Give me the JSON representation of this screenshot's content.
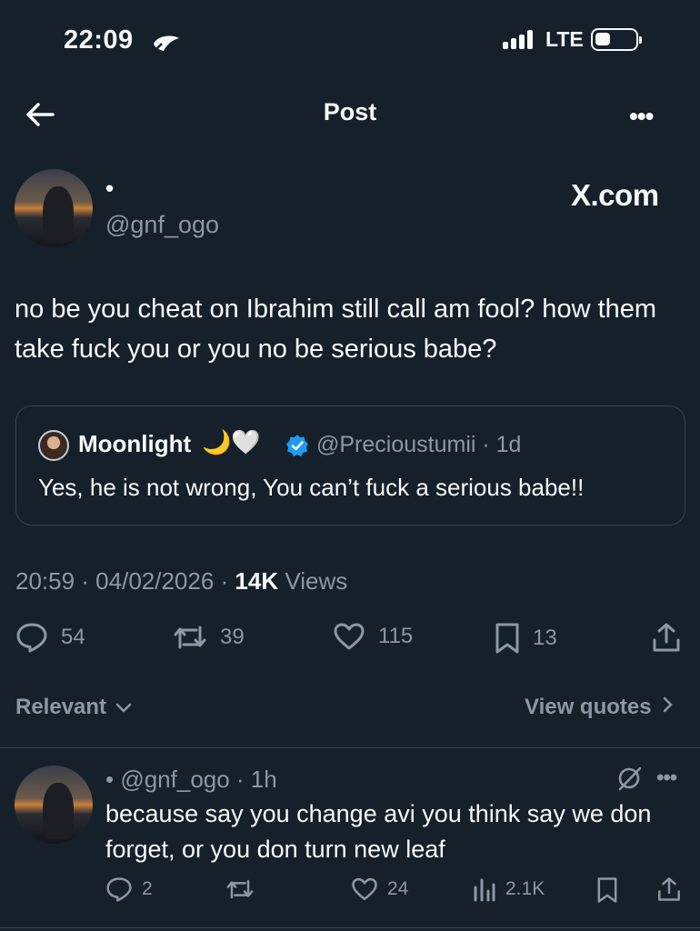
{
  "status": {
    "time": "22:09",
    "network": "LTE"
  },
  "header": {
    "title": "Post"
  },
  "post": {
    "name": "•",
    "handle": "@gnf_ogo",
    "watermark": "X.com",
    "text": "no be you cheat on Ibrahim still call am fool? how them take fuck you or you no be serious babe?",
    "quote": {
      "name": "Moonlight",
      "emoji": "🌙🤍",
      "handle_time": "@Precioustumii · 1d",
      "text": "Yes, he is not wrong, You can’t fuck a serious babe!!"
    },
    "meta": {
      "time_date": "20:59 · 04/02/2026 · ",
      "views_count": "14K",
      "views_label": " Views"
    },
    "stats": {
      "replies": "54",
      "reposts": "39",
      "likes": "115",
      "bookmarks": "13"
    }
  },
  "sort": {
    "relevant": "Relevant",
    "view_quotes": "View quotes"
  },
  "reply": {
    "head": "• @gnf_ogo · 1h",
    "text": "because say you change avi you think say we don forget, or you don turn new leaf",
    "stats": {
      "replies": "2",
      "likes": "24",
      "views": "2.1K"
    }
  },
  "colors": {
    "background": "#15202b",
    "text": "#f7f9f9",
    "muted": "#8b98a5",
    "border": "#38444d",
    "verified": "#1d9bf0"
  }
}
